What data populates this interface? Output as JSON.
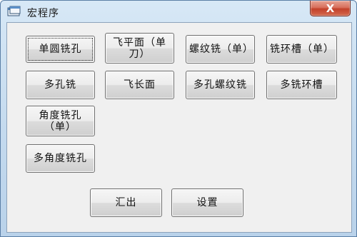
{
  "window": {
    "title": "宏程序",
    "close_label": "X"
  },
  "buttons": {
    "single_round_hole": "单圆铣孔",
    "fly_plane_single": "飞平面（单刀）",
    "thread_mill_single": "螺纹铣（单）",
    "ring_groove_single": "铣环槽（单）",
    "multi_hole_mill": "多孔铣",
    "fly_long_face": "飞长面",
    "multi_hole_thread": "多孔螺纹铣",
    "multi_ring_groove": "多铣环槽",
    "angle_hole_single": "角度铣孔（单）",
    "multi_angle_hole": "多角度铣孔",
    "summary": "汇出",
    "settings": "设置"
  }
}
